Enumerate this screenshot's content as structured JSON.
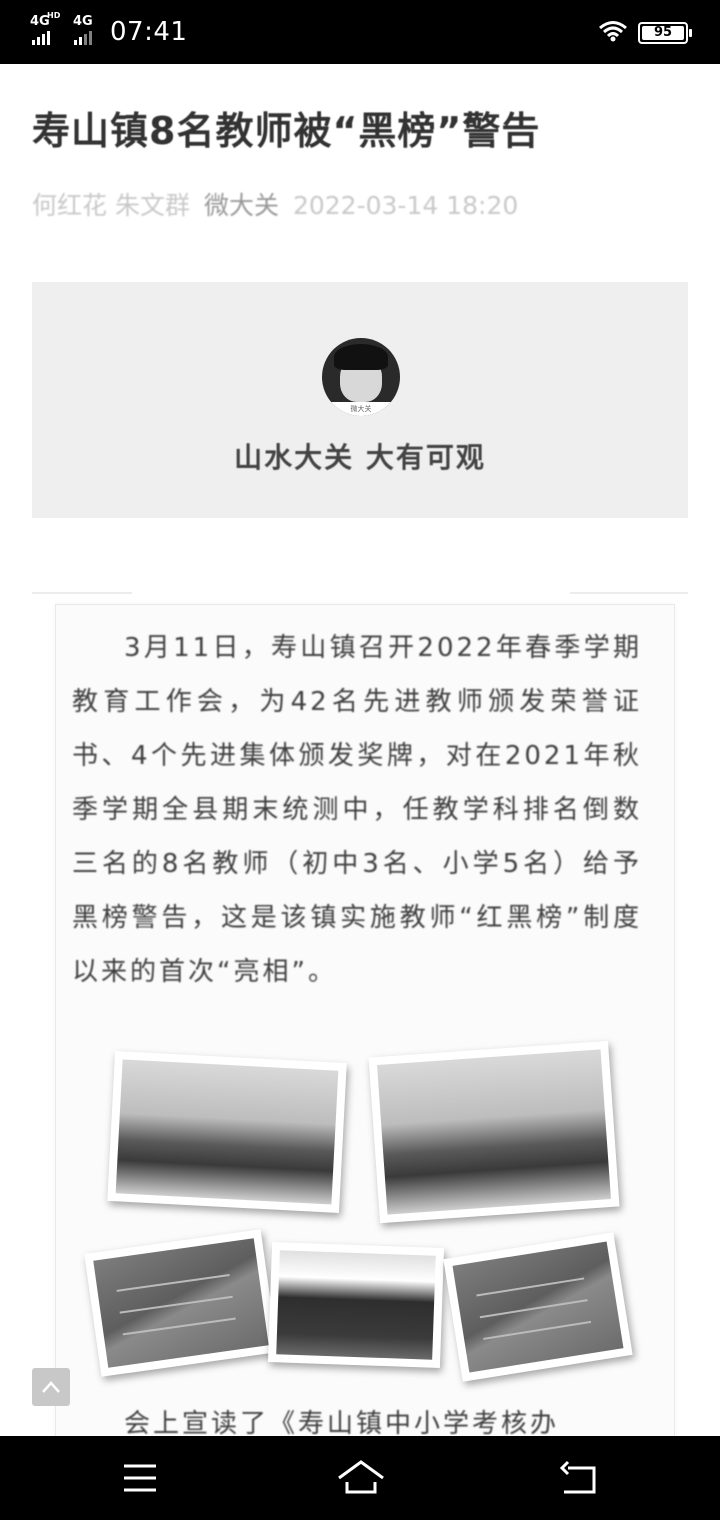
{
  "status_bar": {
    "network_1": "4G",
    "network_1_sup": "HD",
    "network_2": "4G",
    "network_2_sup": "HD",
    "time": "07:41",
    "battery": "95"
  },
  "article": {
    "title": "寿山镇8名教师被“黑榜”警告",
    "authors": "何红花 朱文群",
    "source": "微大关",
    "datetime": "2022-03-14 18:20"
  },
  "profile_card": {
    "avatar_caption": "微大关",
    "slogan": "山水大关 大有可观"
  },
  "notice": {
    "paragraph": "3月11日，寿山镇召开2022年春季学期教育工作会，为42名先进教师颁发荣誉证书、4个先进集体颁发奖牌，对在2021年秋季学期全县期末统测中，任教学科排名倒数三名的8名教师（初中3名、小学5名）给予黑榜警告，这是该镇实施教师“红黑榜”制度以来的首次“亮相”。",
    "cut_off_line": "会上宣读了《寿山镇中小学考核办"
  },
  "icons": {
    "back_to_top": "chevron-up-icon",
    "nav_menu": "menu-icon",
    "nav_home": "home-icon",
    "nav_back": "back-icon"
  }
}
